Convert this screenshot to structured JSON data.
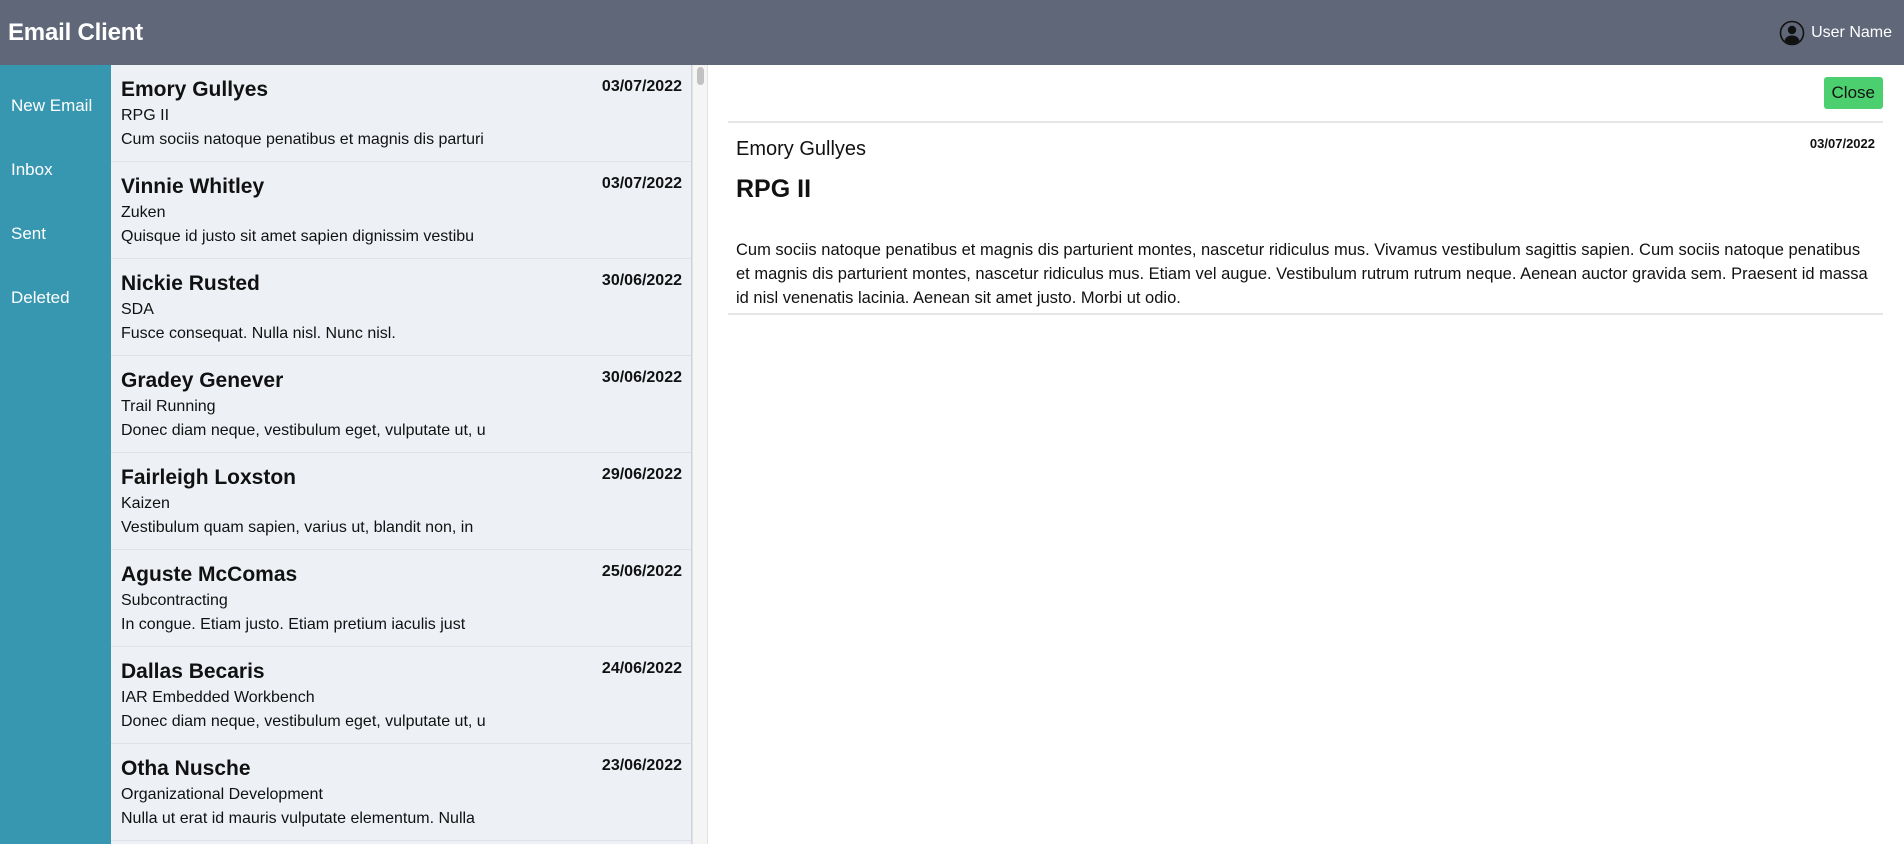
{
  "header": {
    "app_title": "Email Client",
    "user_name": "User Name"
  },
  "sidebar": {
    "items": [
      {
        "label": "New Email"
      },
      {
        "label": "Inbox"
      },
      {
        "label": "Sent"
      },
      {
        "label": "Deleted"
      }
    ]
  },
  "emails": [
    {
      "sender": "Emory Gullyes",
      "date": "03/07/2022",
      "subject": "RPG II",
      "preview": "Cum sociis natoque penatibus et magnis dis parturi"
    },
    {
      "sender": "Vinnie Whitley",
      "date": "03/07/2022",
      "subject": "Zuken",
      "preview": "Quisque id justo sit amet sapien dignissim vestibu"
    },
    {
      "sender": "Nickie Rusted",
      "date": "30/06/2022",
      "subject": "SDA",
      "preview": "Fusce consequat. Nulla nisl. Nunc nisl."
    },
    {
      "sender": "Gradey Genever",
      "date": "30/06/2022",
      "subject": "Trail Running",
      "preview": "Donec diam neque, vestibulum eget, vulputate ut, u"
    },
    {
      "sender": "Fairleigh Loxston",
      "date": "29/06/2022",
      "subject": "Kaizen",
      "preview": "Vestibulum quam sapien, varius ut, blandit non, in"
    },
    {
      "sender": "Aguste McComas",
      "date": "25/06/2022",
      "subject": "Subcontracting",
      "preview": "In congue. Etiam justo. Etiam pretium iaculis just"
    },
    {
      "sender": "Dallas Becaris",
      "date": "24/06/2022",
      "subject": "IAR Embedded Workbench",
      "preview": "Donec diam neque, vestibulum eget, vulputate ut, u"
    },
    {
      "sender": "Otha Nusche",
      "date": "23/06/2022",
      "subject": "Organizational Development",
      "preview": "Nulla ut erat id mauris vulputate elementum. Nulla"
    }
  ],
  "reader": {
    "close_label": "Close",
    "sender": "Emory Gullyes",
    "date": "03/07/2022",
    "subject": "RPG II",
    "body": "Cum sociis natoque penatibus et magnis dis parturient montes, nascetur ridiculus mus. Vivamus vestibulum sagittis sapien. Cum sociis natoque penatibus et magnis dis parturient montes, nascetur ridiculus mus. Etiam vel augue. Vestibulum rutrum rutrum neque. Aenean auctor gravida sem. Praesent id massa id nisl venenatis lacinia. Aenean sit amet justo. Morbi ut odio."
  },
  "colors": {
    "header_bg": "#5f6778",
    "sidebar_bg": "#3797b1",
    "list_bg": "#edf1f6",
    "close_button_bg": "#4cd06f"
  },
  "icons": {
    "user": "user-circle-icon"
  }
}
